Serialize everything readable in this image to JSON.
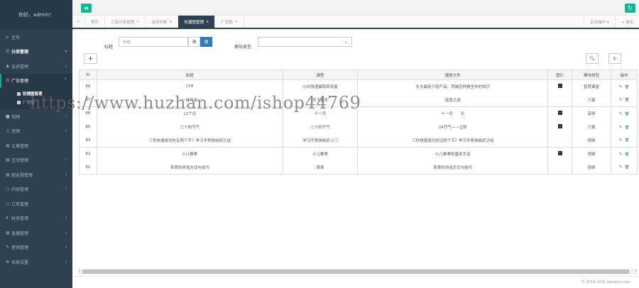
{
  "sidebar": {
    "greeting": "你好，admin！",
    "items": [
      {
        "icon": "home-icon",
        "glyph": "⌂",
        "label": "主页",
        "chev": ""
      },
      {
        "icon": "list-icon",
        "glyph": "☰",
        "label": "分类管理",
        "chev": "‹",
        "bold": true
      },
      {
        "icon": "user-icon",
        "glyph": "♟",
        "label": "会员管理",
        "chev": "‹"
      },
      {
        "icon": "ad-icon",
        "glyph": "☰",
        "label": "广告管理",
        "chev": "˅",
        "active": true
      }
    ],
    "submenu": [
      {
        "label": "轮播图管理",
        "current": true
      },
      {
        "label": "广告图",
        "current": false
      }
    ],
    "items2": [
      {
        "icon": "video-icon",
        "glyph": "■",
        "label": "视频",
        "chev": "‹"
      },
      {
        "icon": "music-icon",
        "glyph": "♫",
        "label": "音频",
        "chev": "‹"
      },
      {
        "icon": "article-icon",
        "glyph": "▤",
        "label": "文章管理",
        "chev": ""
      },
      {
        "icon": "interact-icon",
        "glyph": "▤",
        "label": "互动管理",
        "chev": "‹"
      },
      {
        "icon": "circle-icon",
        "glyph": "▤",
        "label": "朋友圈管理",
        "chev": "‹"
      },
      {
        "icon": "content-icon",
        "glyph": "▢",
        "label": "内容管理",
        "chev": "‹"
      },
      {
        "icon": "order-icon",
        "glyph": "▢",
        "label": "订单管理",
        "chev": ""
      },
      {
        "icon": "finance-icon",
        "glyph": "¥",
        "label": "财务管理",
        "chev": "‹"
      },
      {
        "icon": "live-icon",
        "glyph": "▤",
        "label": "直播管理",
        "chev": "‹"
      },
      {
        "icon": "promo-icon",
        "glyph": "✎",
        "label": "营销管理",
        "chev": "‹"
      },
      {
        "icon": "settings-icon",
        "glyph": "⚙",
        "label": "系统设置",
        "chev": "‹"
      }
    ]
  },
  "topbar": {
    "menu_icon": "≡",
    "refresh_icon": "↻"
  },
  "tabs": {
    "nav_left": "«",
    "list": [
      {
        "label": "首页",
        "active": false,
        "close": ""
      },
      {
        "label": "二级分类管理",
        "active": false,
        "close": "×"
      },
      {
        "label": "会员列表",
        "active": false,
        "close": "×"
      },
      {
        "label": "轮播图管理",
        "active": true,
        "close": "×"
      },
      {
        "label": "广告图",
        "active": false,
        "close": "×"
      }
    ],
    "close_ops": "关闭操作 ▾",
    "logout": "⇥ 退出"
  },
  "filter": {
    "title_label": "标题",
    "title_placeholder": "标题",
    "search_btn": "搜",
    "clear_btn": "清",
    "module_label": "模块类型",
    "module_value": "",
    "add_btn": "+",
    "search_icon": "🔍",
    "refresh_icon": "↻"
  },
  "table": {
    "headers": [
      "ID",
      "标题",
      "课程",
      "播放文件",
      "图片",
      "模块类型",
      "操作"
    ],
    "rows": [
      {
        "id": "86",
        "title": "CF8",
        "course": "小白快速赢取现状者",
        "file": "头头最新介绍产品：顶端怎样做全你的知识",
        "img": true,
        "module": "智慧课堂",
        "sep": true
      },
      {
        "id": "87",
        "title": "一样平米",
        "course": "天下会员",
        "file": "逐层之战",
        "img": false,
        "module": "六家",
        "sep": false
      },
      {
        "id": "86",
        "title": "12个月",
        "course": "十一月",
        "file": "十一月　　头",
        "img": true,
        "module": "音频",
        "sep": true
      },
      {
        "id": "85",
        "title": "二十的节气",
        "course": "二十的节气",
        "file": "24节气——立秋",
        "img": true,
        "module": "六家",
        "sep": false
      },
      {
        "id": "83",
        "title": "三秒快速成功的证两个节？学习手势快收好之经",
        "course": "学习手势快收好入门",
        "file": "三秒快速成功的证两个节？学习手势快收好之经",
        "img": false,
        "module": "视频",
        "sep": false
      },
      {
        "id": "82",
        "title": "小儿推拿",
        "course": "小儿推拿",
        "file": "小儿推拿的基本手法",
        "img": true,
        "module": "视频",
        "sep": true
      },
      {
        "id": "81",
        "title": "茶茶的冲泡方式与技巧",
        "course": "茶茶",
        "file": "茶茶的冲泡方式与技巧",
        "img": false,
        "module": "视频",
        "sep": false
      }
    ],
    "edit_icon": "✎",
    "delete_icon": "🗑"
  },
  "footer": {
    "copyright": "© 2014-2015 qianglus.com"
  },
  "watermark": "https://www.huzhan.com/ishop44769"
}
